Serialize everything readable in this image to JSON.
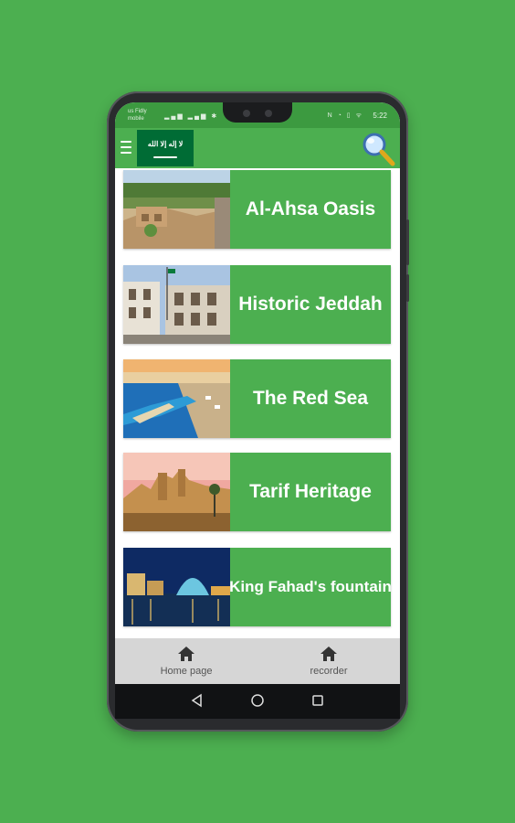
{
  "status_bar": {
    "carrier_line1": "us Fidly",
    "carrier_line2": "mobile",
    "time": "5:22"
  },
  "app_bar": {
    "menu_icon": "hamburger-menu-icon",
    "flag_text": "لا إله إلا الله",
    "search_icon": "magnifier-icon"
  },
  "places": [
    {
      "label": "Al-Ahsa Oasis",
      "image": "oasis-photo"
    },
    {
      "label": "Historic Jeddah",
      "image": "jeddah-buildings-photo"
    },
    {
      "label": "The Red Sea",
      "image": "red-sea-coast-photo"
    },
    {
      "label": "Tarif Heritage",
      "image": "tarif-ruins-photo"
    },
    {
      "label": "King Fahad's fountain",
      "image": "fountain-night-photo"
    }
  ],
  "bottom_nav": [
    {
      "label": "Home page",
      "icon": "home-icon"
    },
    {
      "label": "recorder",
      "icon": "home-icon"
    }
  ],
  "colors": {
    "primary": "#4caf50",
    "status_bar": "#3c9a40",
    "flag": "#006c35",
    "bottom_nav": "#d6d6d6"
  }
}
